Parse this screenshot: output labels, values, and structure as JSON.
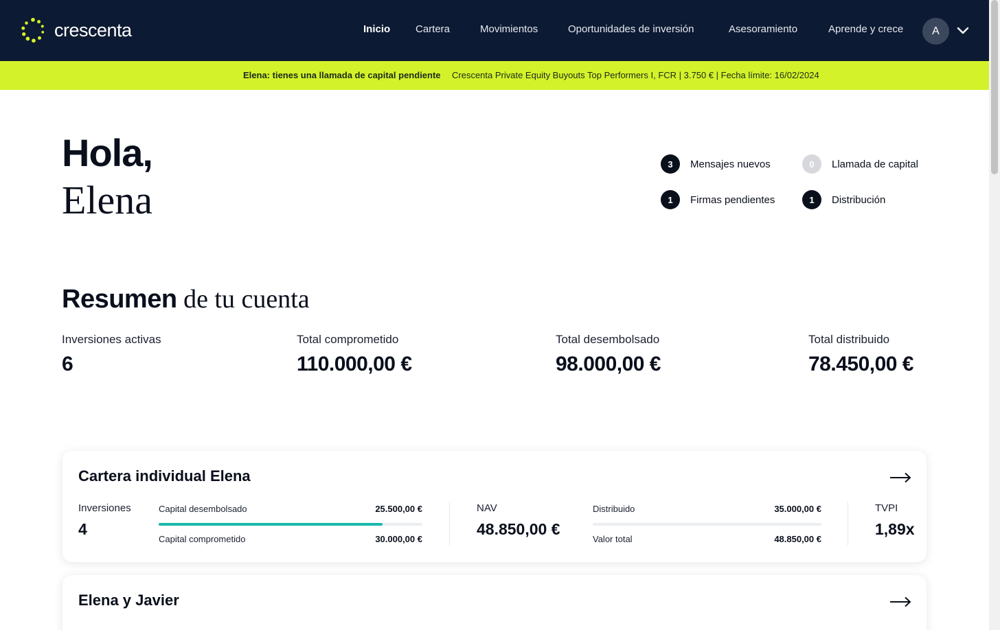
{
  "header": {
    "logo_text": "crescenta",
    "nav": [
      {
        "label": "Inicio",
        "active": true
      },
      {
        "label": "Cartera",
        "active": false
      },
      {
        "label": "Movimientos",
        "active": false
      },
      {
        "label": "Oportunidades de inversión",
        "active": false
      },
      {
        "label": "Asesoramiento",
        "active": false
      },
      {
        "label": "Aprende y crece",
        "active": false
      }
    ],
    "avatar_initial": "A",
    "colors": {
      "bar": "#0c1a33",
      "accent": "#d4f22a"
    }
  },
  "banner": {
    "strong": "Elena: tienes una llamada de capital pendiente",
    "text": "Crescenta Private Equity Buyouts Top Performers I, FCR | 3.750 € | Fecha límite: 16/02/2024"
  },
  "greeting": {
    "hello": "Hola,",
    "name": "Elena"
  },
  "notifications": [
    {
      "count": "3",
      "label": "Mensajes nuevos"
    },
    {
      "count": "0",
      "label": "Llamada de capital"
    },
    {
      "count": "1",
      "label": "Firmas pendientes"
    },
    {
      "count": "1",
      "label": "Distribución"
    }
  ],
  "summary": {
    "title_bold": "Resumen",
    "title_serif": " de tu cuenta",
    "stats": [
      {
        "label": "Inversiones activas",
        "value": "6"
      },
      {
        "label": "Total comprometido",
        "value": "110.000,00 €"
      },
      {
        "label": "Total desembolsado",
        "value": "98.000,00 €"
      },
      {
        "label": "Total distribuido",
        "value": "78.450,00 €"
      }
    ]
  },
  "portfolios": [
    {
      "title": "Cartera individual Elena",
      "inversiones_label": "Inversiones",
      "inversiones": "4",
      "capital_desembolsado_label": "Capital desembolsado",
      "capital_desembolsado": "25.500,00 €",
      "capital_comprometido_label": "Capital comprometido",
      "capital_comprometido": "30.000,00 €",
      "desembolsado_fraction": 0.85,
      "nav_label": "NAV",
      "nav": "48.850,00 €",
      "distribuido_label": "Distribuido",
      "distribuido": "35.000,00 €",
      "valor_total_label": "Valor total",
      "valor_total": "48.850,00 €",
      "tvpi_label": "TVPI",
      "tvpi": "1,89x",
      "bar_color": "#19b8ac"
    },
    {
      "title": "Elena y Javier"
    }
  ]
}
